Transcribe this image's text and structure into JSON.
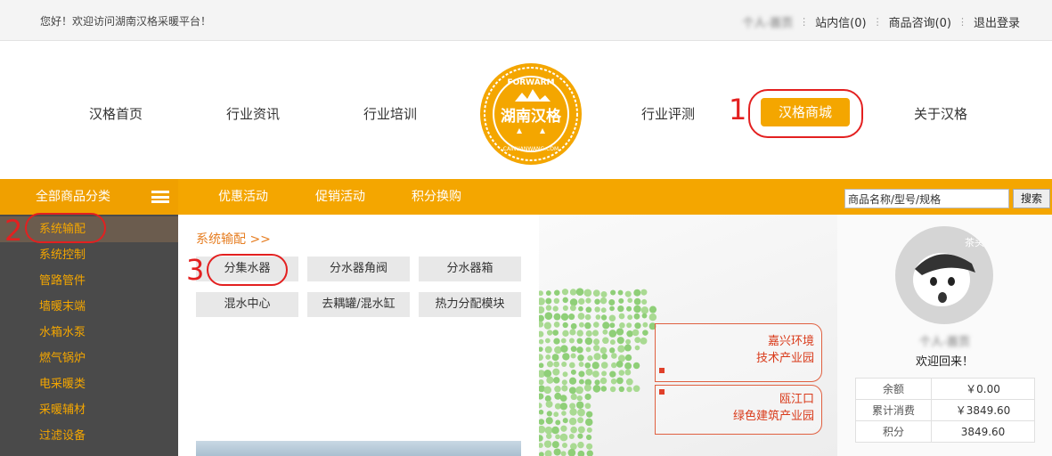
{
  "topbar": {
    "welcome": "您好！欢迎访问湖南汉格采暖平台！",
    "user": "个人-首页",
    "inbox": "站内信(0)",
    "consult": "商品咨询(0)",
    "logout": "退出登录"
  },
  "nav": {
    "home": "汉格首页",
    "news": "行业资讯",
    "training": "行业培训",
    "review": "行业评测",
    "mall": "汉格商城",
    "about": "关于汉格"
  },
  "logo": {
    "main": "湖南汉格",
    "top": "FORWARM",
    "bottom": "CAINUANWANG.COM"
  },
  "annotations": {
    "a1": "1",
    "a2": "2",
    "a3": "3"
  },
  "category_bar": {
    "all": "全部商品分类",
    "menu": [
      "优惠活动",
      "促销活动",
      "积分换购"
    ]
  },
  "search": {
    "placeholder": "商品名称/型号/规格",
    "button": "搜索"
  },
  "sidebar": {
    "items": [
      "系统输配",
      "系统控制",
      "管路管件",
      "墙暖末端",
      "水箱水泵",
      "燃气锅炉",
      "电采暖类",
      "采暖辅材",
      "过滤设备"
    ]
  },
  "panel": {
    "title": "系统输配 >>",
    "tags": [
      "分集水器",
      "分水器角阀",
      "分水器箱",
      "混水中心",
      "去耦罐/混水缸",
      "热力分配模块"
    ]
  },
  "map": {
    "callout1": [
      "嘉兴环境",
      "技术产业园"
    ],
    "callout2": [
      "瓯江口",
      "绿色建筑产业园"
    ]
  },
  "user_panel": {
    "avatar_label": "茶头猫",
    "name": "个人-首页",
    "greeting": "欢迎回来！",
    "rows": [
      {
        "k": "余额",
        "v": "￥0.00"
      },
      {
        "k": "累计消费",
        "v": "￥3849.60"
      },
      {
        "k": "积分",
        "v": "3849.60"
      }
    ]
  },
  "colors": {
    "accent": "#f4a600",
    "sidebar": "#4a4a4a",
    "annotation": "#e32020"
  }
}
